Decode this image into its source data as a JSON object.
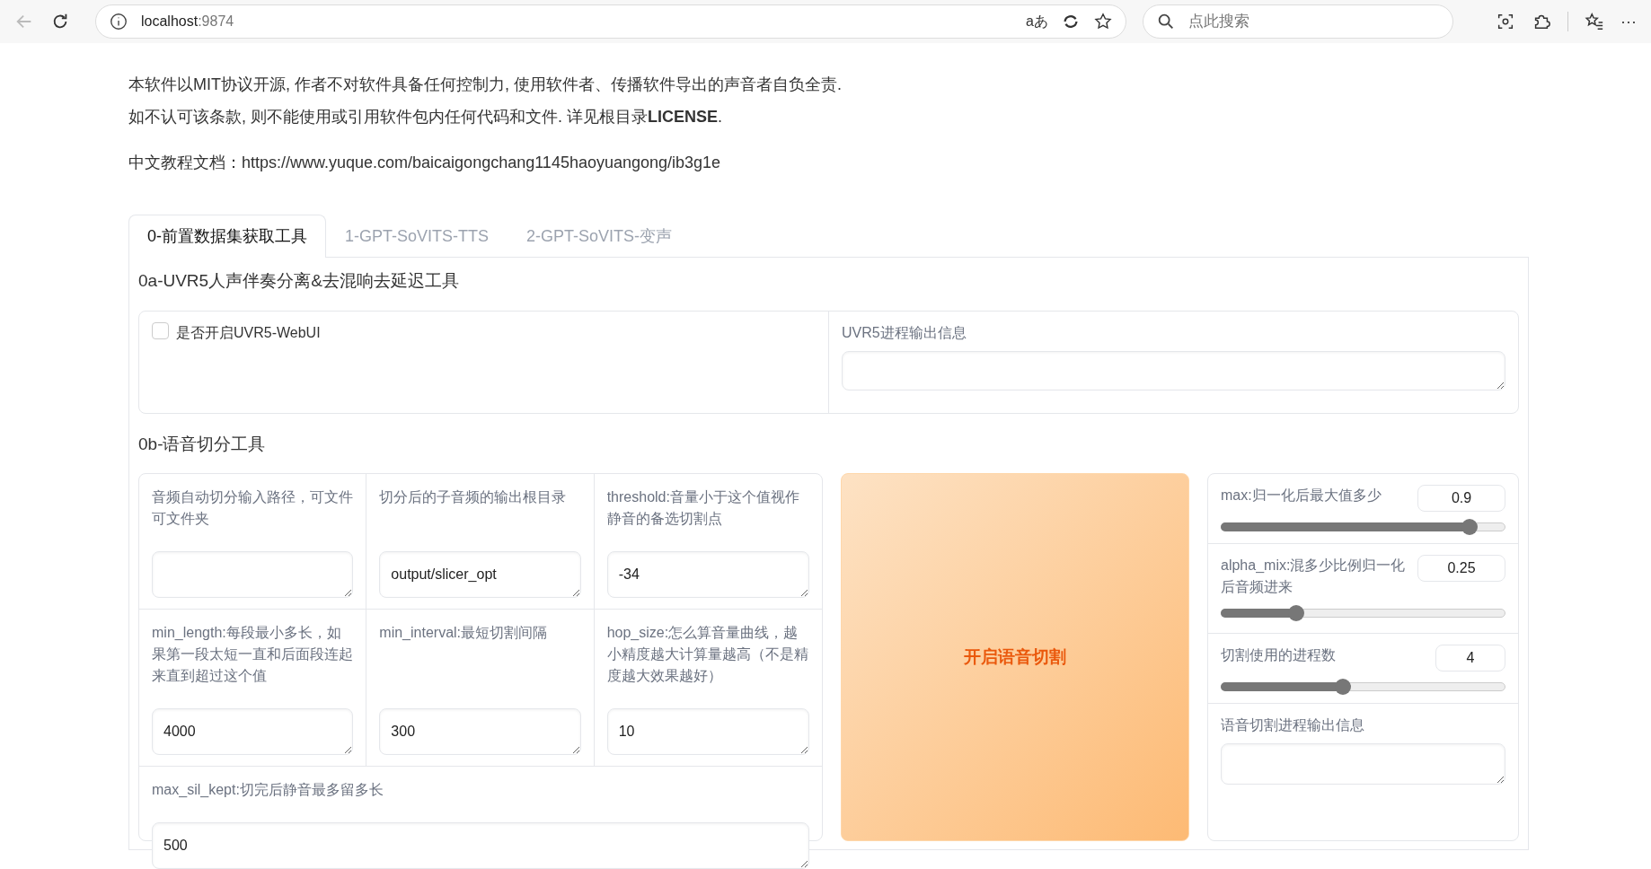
{
  "browser": {
    "url_host": "localhost",
    "url_port": ":9874",
    "read_aloud": "aあ",
    "search": {
      "placeholder": "点此搜索"
    },
    "more": "···"
  },
  "notice": [
    "本软件以MIT协议开源, 作者不对软件具备任何控制力, 使用软件者、传播软件导出的声音者自负全责.",
    "如不认可该条款, 则不能使用或引用软件包内任何代码和文件. 详见根目录**LICENSE**."
  ],
  "doc_link": {
    "label": "中文教程文档：",
    "url": "https://www.yuque.com/baicaigongchang1145haoyuangong/ib3g1e"
  },
  "tabs": [
    {
      "label": "0-前置数据集获取工具",
      "selected": true
    },
    {
      "label": "1-GPT-SoVITS-TTS",
      "selected": false
    },
    {
      "label": "2-GPT-SoVITS-变声",
      "selected": false
    }
  ],
  "uvr5": {
    "title": "0a-UVR5人声伴奏分离&去混响去延迟工具",
    "checkbox": {
      "label": "是否开启UVR5-WebUI",
      "checked": false
    },
    "output": {
      "label": "UVR5进程输出信息"
    }
  },
  "slicer": {
    "title": "0b-语音切分工具",
    "fields": [
      {
        "label": "音频自动切分输入路径，可文件可文件夹"
      },
      {
        "label": "切分后的子音频的输出根目录",
        "value": "output/slicer_opt"
      },
      {
        "label": "threshold:音量小于这个值视作静音的备选切割点",
        "value": "-34"
      },
      {
        "label": "min_length:每段最小多长，如果第一段太短一直和后面段连起来直到超过这个值",
        "value": "4000"
      },
      {
        "label": "min_interval:最短切割间隔",
        "value": "300"
      },
      {
        "label": "hop_size:怎么算音量曲线，越小精度越大计算量越高（不是精度越大效果越好）",
        "value": "10"
      },
      {
        "label": "max_sil_kept:切完后静音最多留多长",
        "value": "500"
      }
    ],
    "button": "开启语音切割",
    "sliders": [
      {
        "label": "max:归一化后最大值多少",
        "value": "0.9",
        "level": 0.876
      },
      {
        "label": "alpha_mix:混多少比例归一化后音频进来",
        "value": "0.25",
        "level": 0.265
      },
      {
        "label": "切割使用的进程数",
        "value": "4",
        "level": 0.43
      }
    ],
    "output": {
      "label": "语音切割进程输出信息"
    }
  }
}
